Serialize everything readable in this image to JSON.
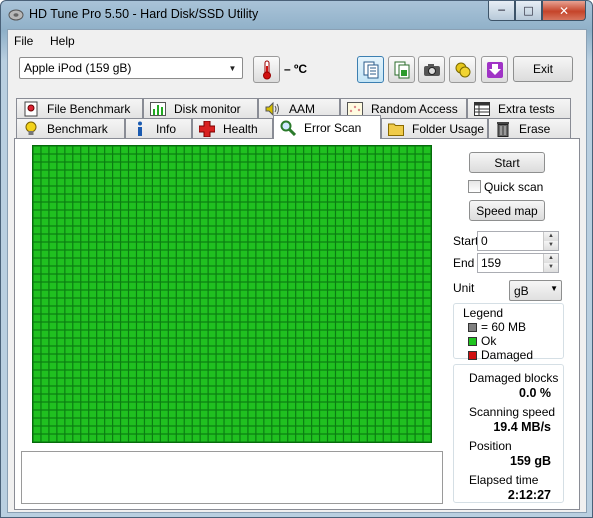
{
  "window": {
    "title": "HD Tune Pro 5.50 - Hard Disk/SSD Utility",
    "buttons": {
      "minimize": "─",
      "maximize": "□",
      "close": "✕"
    }
  },
  "menu": {
    "file": "File",
    "help": "Help"
  },
  "toolbar": {
    "drive": "Apple   iPod (159 gB)",
    "temperature": "– ºC",
    "exit_label": "Exit",
    "icons": [
      "thermometer-icon",
      "copy-text-icon",
      "copy-image-icon",
      "camera-icon",
      "gold-coins-icon",
      "download-arrow-icon"
    ]
  },
  "tabs": {
    "row_back": [
      "File Benchmark",
      "Disk monitor",
      "AAM",
      "Random Access",
      "Extra tests"
    ],
    "row_front": [
      "Benchmark",
      "Info",
      "Health",
      "Error Scan",
      "Folder Usage",
      "Erase"
    ],
    "selected": "Error Scan"
  },
  "error_scan": {
    "start_button": "Start",
    "quick_scan_label": "Quick scan",
    "quick_scan_checked": false,
    "speed_map_button": "Speed map",
    "start_label": "Start",
    "start_value": "0",
    "end_label": "End",
    "end_value": "159",
    "unit_label": "Unit",
    "unit_value": "gB",
    "legend": {
      "title": "Legend",
      "block": "= 60 MB",
      "ok": "Ok",
      "damaged": "Damaged",
      "colors": {
        "block": "#808080",
        "ok": "#1fc41f",
        "damaged": "#d01010"
      }
    },
    "stats": {
      "damaged_blocks_label": "Damaged blocks",
      "damaged_blocks_value": "0.0 %",
      "scanning_speed_label": "Scanning speed",
      "scanning_speed_value": "19.4 MB/s",
      "position_label": "Position",
      "position_value": "159 gB",
      "elapsed_label": "Elapsed time",
      "elapsed_value": "2:12:27"
    },
    "scan_grid": {
      "columns": 50,
      "rows": 37,
      "status": "all-ok",
      "cell_color": "#20c020"
    }
  }
}
